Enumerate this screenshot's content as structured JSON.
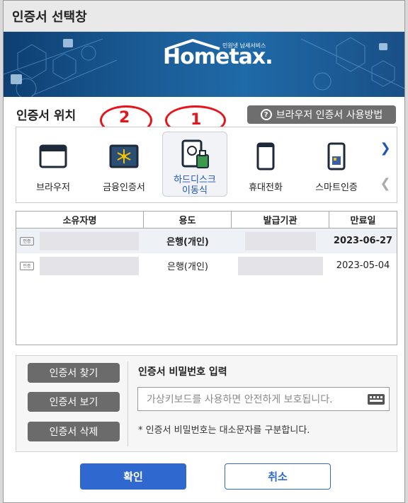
{
  "window": {
    "title": "인증서 선택창"
  },
  "banner": {
    "logo_text": "Hometax.",
    "logo_sub": "민원넷 납세서비스"
  },
  "location": {
    "title": "인증서 위치",
    "help_label": "브라우저 인증서 사용방법",
    "items": [
      {
        "label": "브라우저",
        "icon": "browser-icon"
      },
      {
        "label": "금융인증서",
        "icon": "financial-cert-icon"
      },
      {
        "label": "하드디스크\n이동식",
        "icon": "harddisk-icon",
        "selected": true
      },
      {
        "label": "휴대전화",
        "icon": "phone-icon"
      },
      {
        "label": "스마트인증",
        "icon": "smart-cert-icon"
      }
    ]
  },
  "annotations": [
    "2",
    "1"
  ],
  "table": {
    "headers": [
      "소유자명",
      "용도",
      "발급기관",
      "만료일"
    ],
    "rows": [
      {
        "owner": "",
        "usage": "은행(개인)",
        "issuer": "",
        "expiry": "2023-06-27",
        "selected": true
      },
      {
        "owner": "",
        "usage": "은행(개인)",
        "issuer": "",
        "expiry": "2023-05-04",
        "selected": false
      }
    ]
  },
  "actions": {
    "find": "인증서 찾기",
    "view": "인증서 보기",
    "delete": "인증서 삭제"
  },
  "password": {
    "label": "인증서 비밀번호 입력",
    "placeholder": "가상키보드를 사용하면 안전하게 보호됩니다.",
    "note": "* 인증서 비밀번호는 대소문자를 구분합니다."
  },
  "footer": {
    "ok": "확인",
    "cancel": "취소"
  },
  "colors": {
    "primary": "#2f69cf",
    "annotation": "#e8141b",
    "banner": "#1b5b95"
  }
}
